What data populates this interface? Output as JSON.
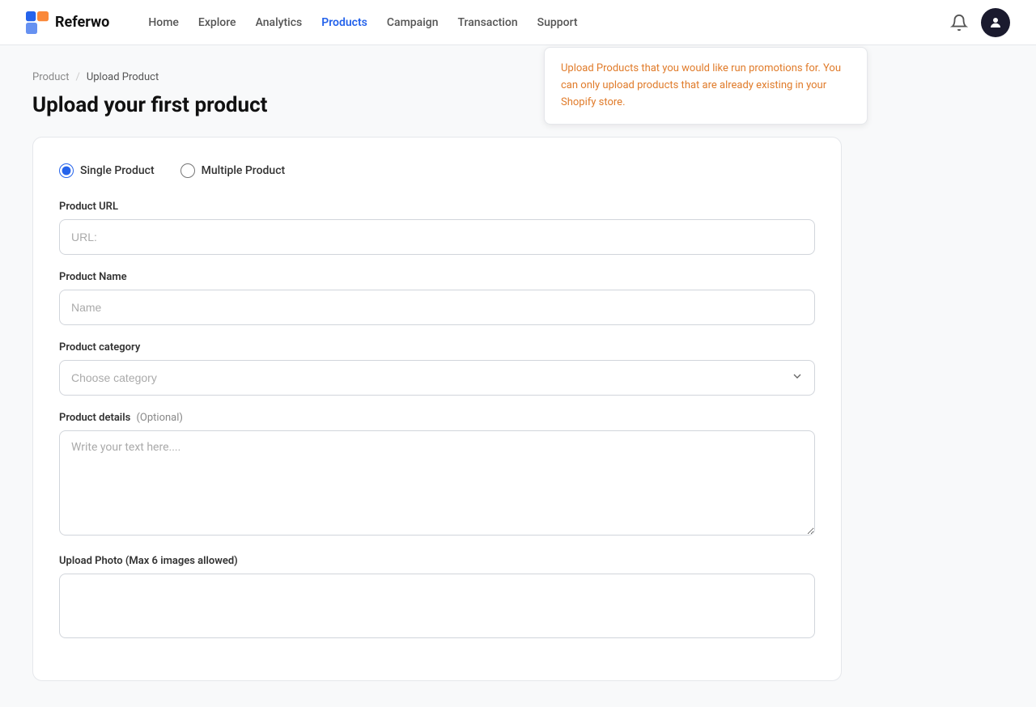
{
  "brand": {
    "name": "Referwo"
  },
  "nav": {
    "links": [
      {
        "label": "Home",
        "active": false
      },
      {
        "label": "Explore",
        "active": false
      },
      {
        "label": "Analytics",
        "active": false
      },
      {
        "label": "Products",
        "active": true
      },
      {
        "label": "Campaign",
        "active": false
      },
      {
        "label": "Transaction",
        "active": false
      },
      {
        "label": "Support",
        "active": false
      }
    ]
  },
  "breadcrumb": {
    "parent": "Product",
    "separator": "/",
    "current": "Upload Product"
  },
  "page": {
    "title": "Upload your first product",
    "info_text": "Upload Products that you would like run promotions for. You can only upload products that are already existing in your Shopify store."
  },
  "form": {
    "radio_options": [
      {
        "label": "Single Product",
        "selected": true
      },
      {
        "label": "Multiple Product",
        "selected": false
      }
    ],
    "product_url": {
      "label": "Product URL",
      "placeholder": "URL:"
    },
    "product_name": {
      "label": "Product Name",
      "placeholder": "Name"
    },
    "product_category": {
      "label": "Product category",
      "placeholder": "Choose category"
    },
    "product_details": {
      "label": "Product details",
      "optional": "(Optional)",
      "placeholder": "Write your text here...."
    },
    "upload_photo": {
      "label": "Upload Photo (Max 6 images allowed)"
    }
  }
}
